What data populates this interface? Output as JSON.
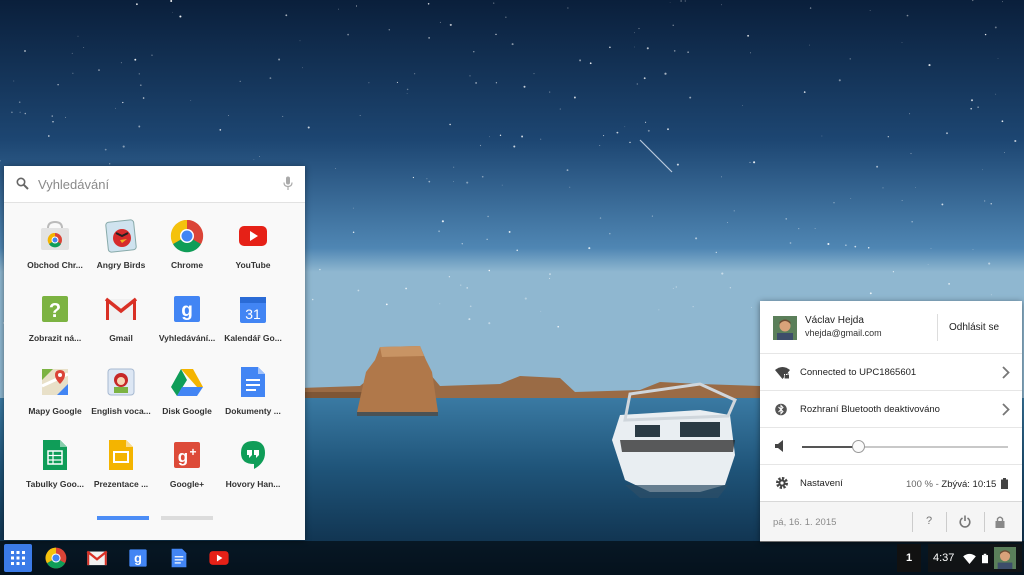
{
  "launcher": {
    "search_placeholder": "Vyhledávání",
    "apps": [
      {
        "label": "Obchod Chr...",
        "icon": "chrome-web-store-icon"
      },
      {
        "label": "Angry Birds",
        "icon": "angry-birds-icon"
      },
      {
        "label": "Chrome",
        "icon": "chrome-icon"
      },
      {
        "label": "YouTube",
        "icon": "youtube-icon"
      },
      {
        "label": "Zobrazit ná...",
        "icon": "help-icon"
      },
      {
        "label": "Gmail",
        "icon": "gmail-icon"
      },
      {
        "label": "Vyhledávání...",
        "icon": "google-search-icon"
      },
      {
        "label": "Kalendář Go...",
        "icon": "calendar-icon"
      },
      {
        "label": "Mapy Google",
        "icon": "maps-icon"
      },
      {
        "label": "English voca...",
        "icon": "english-vocab-icon"
      },
      {
        "label": "Disk Google",
        "icon": "drive-icon"
      },
      {
        "label": "Dokumenty ...",
        "icon": "docs-icon"
      },
      {
        "label": "Tabulky Goo...",
        "icon": "sheets-icon"
      },
      {
        "label": "Prezentace ...",
        "icon": "slides-icon"
      },
      {
        "label": "Google+",
        "icon": "google-plus-icon"
      },
      {
        "label": "Hovory Han...",
        "icon": "hangouts-icon"
      }
    ],
    "calendar_day": "31",
    "active_page": 1,
    "page_count": 2
  },
  "shelf": {
    "pinned_apps": [
      "chrome-icon",
      "gmail-icon",
      "google-search-icon",
      "docs-icon",
      "youtube-icon"
    ],
    "page_counter": "1",
    "clock": "4:37"
  },
  "tray": {
    "user_name": "Václav Hejda",
    "user_email": "vhejda@gmail.com",
    "signout_label": "Odhlásit se",
    "network_label": "Connected to UPC1865601",
    "bluetooth_label": "Rozhraní Bluetooth deaktivováno",
    "volume_level": 0.27,
    "settings_label": "Nastavení",
    "battery_percent": "100 %",
    "battery_separator": " - ",
    "battery_remaining": "Zbývá: 10:15",
    "date": "pá, 16. 1. 2015",
    "help_label": "?"
  },
  "colors": {
    "accent": "#4c8df6",
    "launcher_button": "#3b7be8"
  }
}
